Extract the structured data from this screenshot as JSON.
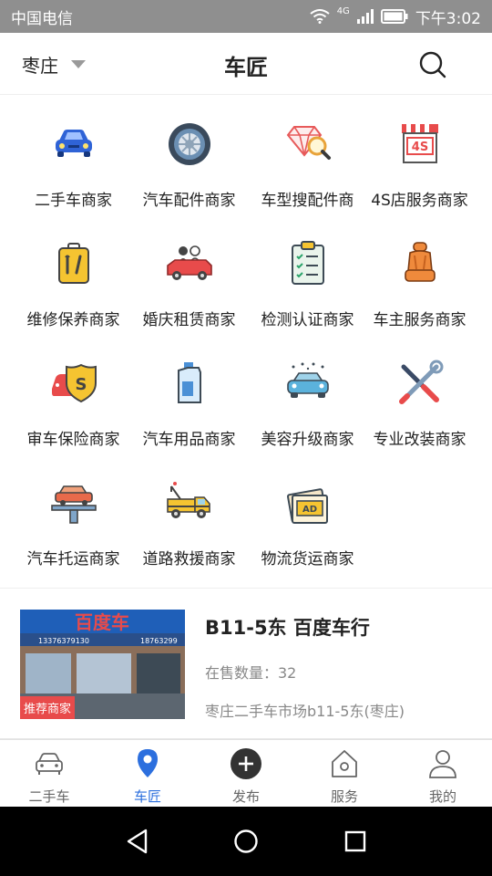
{
  "status": {
    "carrier": "中国电信",
    "network": "4G",
    "time": "下午3:02"
  },
  "header": {
    "city": "枣庄",
    "title": "车匠"
  },
  "categories": [
    {
      "label": "二手车商家",
      "icon": "car-icon"
    },
    {
      "label": "汽车配件商家",
      "icon": "tire-icon"
    },
    {
      "label": "车型搜配件商",
      "icon": "diamond-search-icon"
    },
    {
      "label": "4S店服务商家",
      "icon": "4s-store-icon"
    },
    {
      "label": "维修保养商家",
      "icon": "repair-kit-icon"
    },
    {
      "label": "婚庆租赁商家",
      "icon": "wedding-car-icon"
    },
    {
      "label": "检测认证商家",
      "icon": "checklist-icon"
    },
    {
      "label": "车主服务商家",
      "icon": "car-seat-icon"
    },
    {
      "label": "审车保险商家",
      "icon": "insurance-icon"
    },
    {
      "label": "汽车用品商家",
      "icon": "oil-bottle-icon"
    },
    {
      "label": "美容升级商家",
      "icon": "car-wash-icon"
    },
    {
      "label": "专业改装商家",
      "icon": "tools-icon"
    },
    {
      "label": "汽车托运商家",
      "icon": "car-lift-icon"
    },
    {
      "label": "道路救援商家",
      "icon": "tow-truck-icon"
    },
    {
      "label": "物流货运商家",
      "icon": "ad-ticket-icon"
    }
  ],
  "merchant": {
    "name": "B11-5东 百度车行",
    "count": "在售数量：32",
    "address": "枣庄二手车市场b11-5东(枣庄)",
    "badge": "推荐商家",
    "sign_text": "百度车",
    "phone_a": "13376379130",
    "phone_b": "18763299"
  },
  "tabs": [
    {
      "label": "二手车",
      "icon": "car-outline-icon"
    },
    {
      "label": "车匠",
      "icon": "location-pin-icon"
    },
    {
      "label": "发布",
      "icon": "plus-circle-icon"
    },
    {
      "label": "服务",
      "icon": "home-icon"
    },
    {
      "label": "我的",
      "icon": "user-icon"
    }
  ],
  "colors": {
    "accent": "#2c6fde",
    "badge": "#e84b4b"
  }
}
